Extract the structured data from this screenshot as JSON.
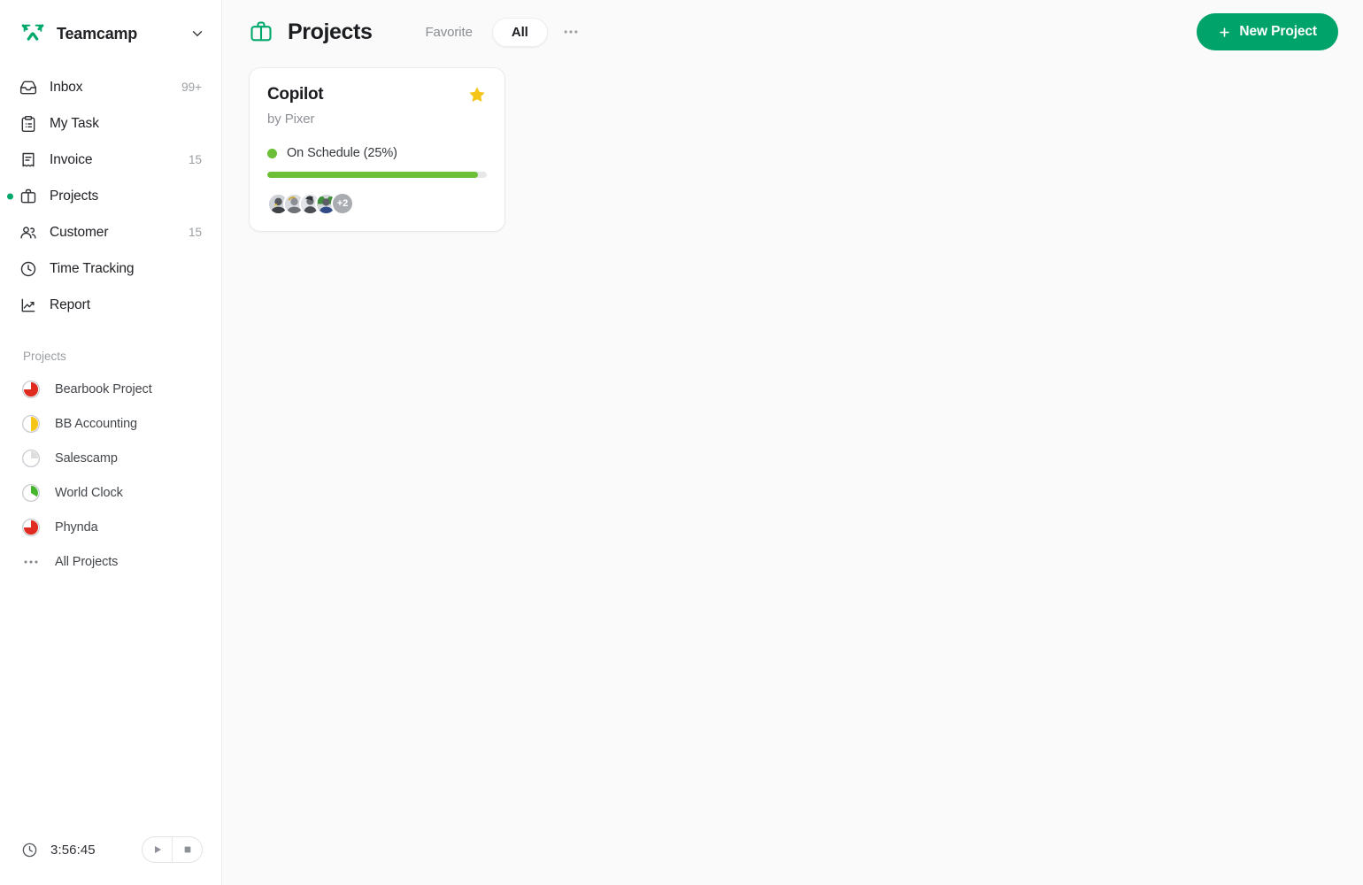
{
  "brand": {
    "name": "Teamcamp",
    "logo_icon": "teamcamp-logo-icon",
    "caret_icon": "chevron-down-icon"
  },
  "sidebar": {
    "nav": [
      {
        "label": "Inbox",
        "badge": "99+",
        "icon": "inbox-icon",
        "active": false
      },
      {
        "label": "My Task",
        "badge": "",
        "icon": "clipboard-icon",
        "active": false
      },
      {
        "label": "Invoice",
        "badge": "15",
        "icon": "invoice-icon",
        "active": false
      },
      {
        "label": "Projects",
        "badge": "",
        "icon": "briefcase-icon",
        "active": true
      },
      {
        "label": "Customer",
        "badge": "15",
        "icon": "users-icon",
        "active": false
      },
      {
        "label": "Time Tracking",
        "badge": "",
        "icon": "clock-icon",
        "active": false
      },
      {
        "label": "Report",
        "badge": "",
        "icon": "chart-line-icon",
        "active": false
      }
    ],
    "projects_heading": "Projects",
    "projects": [
      {
        "label": "Bearbook Project",
        "pie_percent": 75,
        "pie_color": "#e02b20"
      },
      {
        "label": "BB Accounting",
        "pie_percent": 50,
        "pie_color": "#f5c518"
      },
      {
        "label": "Salescamp",
        "pie_percent": 25,
        "pie_color": "#dddddd"
      },
      {
        "label": "World Clock",
        "pie_percent": 15,
        "pie_color": "#46b62c"
      },
      {
        "label": "Phynda",
        "pie_percent": 75,
        "pie_color": "#e02b20"
      }
    ],
    "all_projects_label": "All Projects",
    "all_projects_icon": "ellipsis-icon"
  },
  "timer": {
    "clock_icon": "clock-icon",
    "value": "3:56:45",
    "play_icon": "play-icon",
    "stop_icon": "stop-icon"
  },
  "header": {
    "page_icon": "briefcase-icon",
    "title": "Projects",
    "tabs": [
      {
        "label": "Favorite",
        "active": false
      },
      {
        "label": "All",
        "active": true
      }
    ],
    "more_icon": "ellipsis-icon",
    "new_project_label": "New Project",
    "plus_icon": "plus-icon",
    "accent_color": "#00a36a"
  },
  "cards": [
    {
      "title": "Copilot",
      "subtitle": "by Pixer",
      "favorite": true,
      "star_icon": "star-filled-icon",
      "star_color": "#f5c518",
      "status_text": "On Schedule (25%)",
      "status_color": "#6cbf36",
      "progress_percent": 96,
      "members_overflow": "+2",
      "member_count": 4
    }
  ]
}
